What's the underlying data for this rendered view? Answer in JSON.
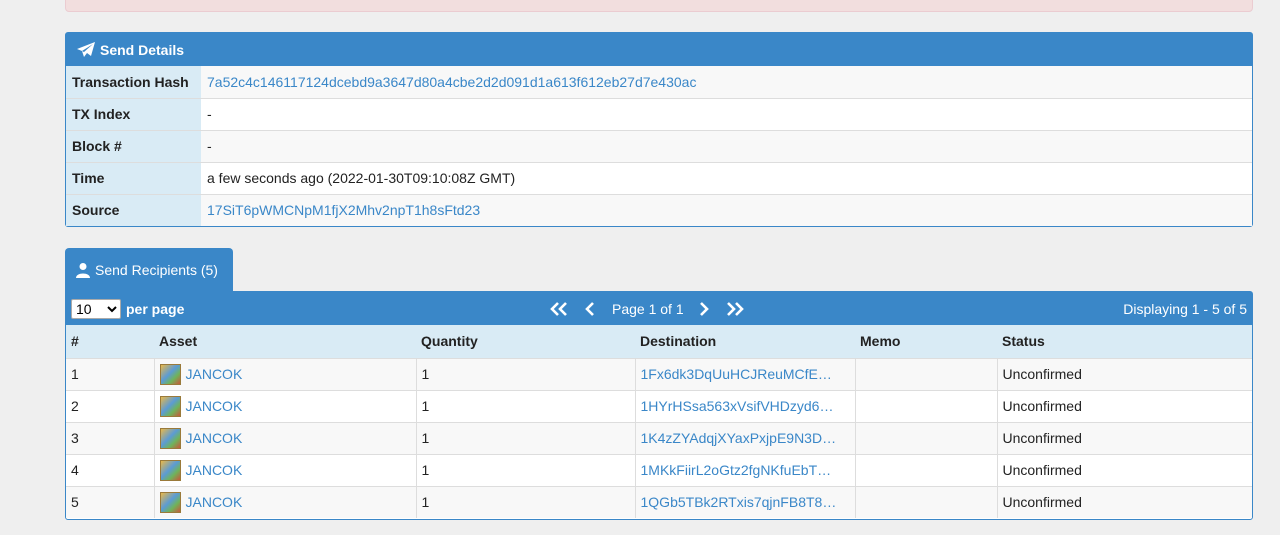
{
  "send_details": {
    "title": "Send Details",
    "rows": [
      {
        "label": "Transaction Hash",
        "value": "7a52c4c146117124dcebd9a3647d80a4cbe2d2d091d1a613f612eb27d7e430ac"
      },
      {
        "label": "TX Index",
        "value": "-"
      },
      {
        "label": "Block #",
        "value": "-"
      },
      {
        "label": "Time",
        "value": "a few seconds ago (2022-01-30T09:10:08Z GMT)"
      },
      {
        "label": "Source",
        "value": "17SiT6pWMCNpM1fjX2Mhv2npT1h8sFtd23"
      }
    ]
  },
  "recipients": {
    "tab_label": "Send Recipients (5)",
    "per_page_selected": "10",
    "per_page_label": "per page",
    "page_label": "Page 1 of 1",
    "displaying": "Displaying 1 - 5 of 5",
    "columns": [
      "#",
      "Asset",
      "Quantity",
      "Destination",
      "Memo",
      "Status"
    ],
    "rows": [
      {
        "n": "1",
        "asset": "JANCOK",
        "qty": "1",
        "dest": "1Fx6dk3DqUuHCJReuMCfE…",
        "memo": "",
        "status": "Unconfirmed"
      },
      {
        "n": "2",
        "asset": "JANCOK",
        "qty": "1",
        "dest": "1HYrHSsa563xVsifVHDzyd6…",
        "memo": "",
        "status": "Unconfirmed"
      },
      {
        "n": "3",
        "asset": "JANCOK",
        "qty": "1",
        "dest": "1K4zZYAdqjXYaxPxjpE9N3D…",
        "memo": "",
        "status": "Unconfirmed"
      },
      {
        "n": "4",
        "asset": "JANCOK",
        "qty": "1",
        "dest": "1MKkFiirL2oGtz2fgNKfuEbT…",
        "memo": "",
        "status": "Unconfirmed"
      },
      {
        "n": "5",
        "asset": "JANCOK",
        "qty": "1",
        "dest": "1QGb5TBk2RTxis7qjnFB8T8…",
        "memo": "",
        "status": "Unconfirmed"
      }
    ]
  },
  "colors": {
    "primary": "#3a87c8",
    "header_bg": "#d9ebf5"
  }
}
